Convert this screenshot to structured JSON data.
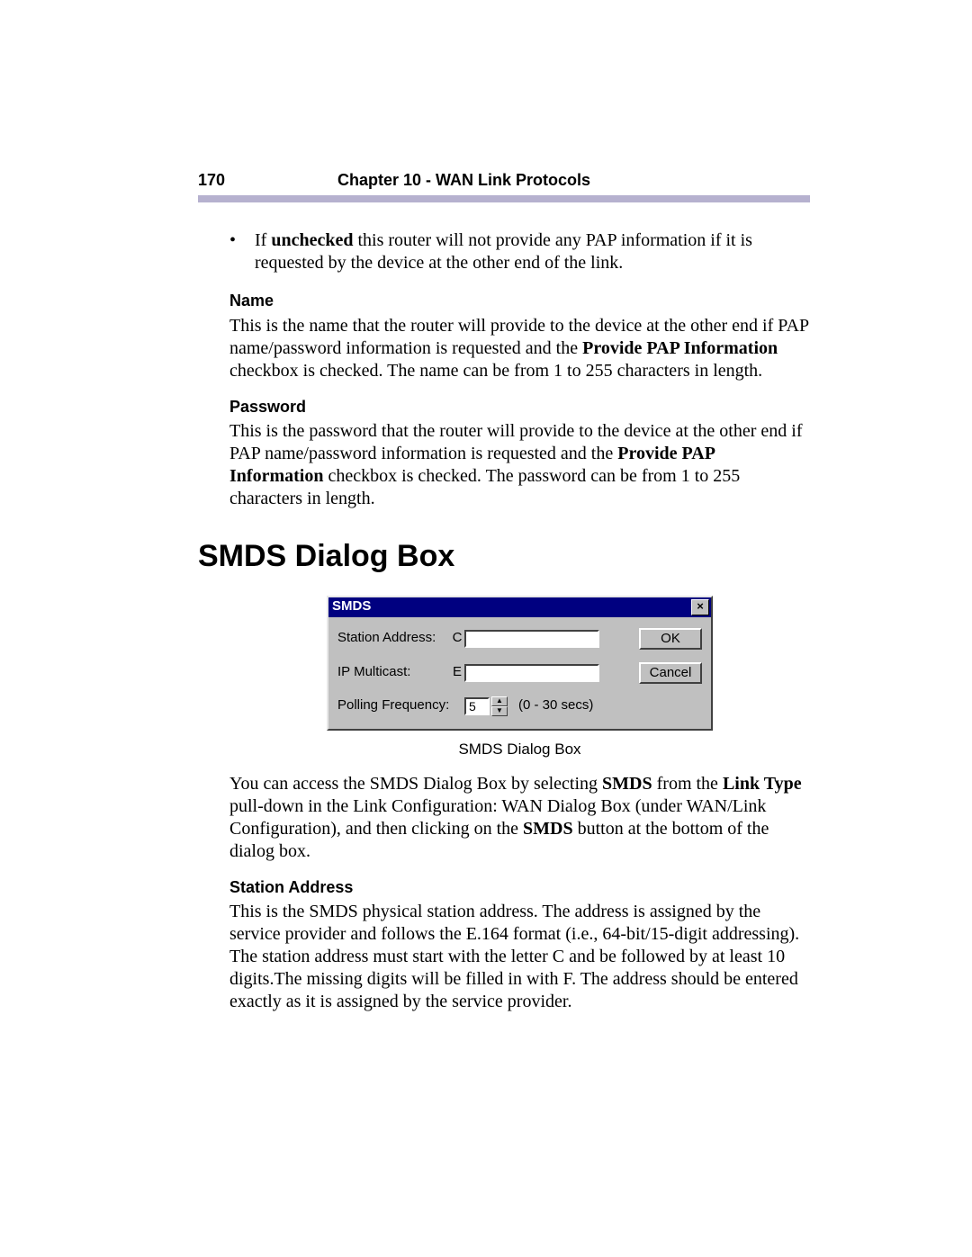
{
  "header": {
    "page_number": "170",
    "chapter": "Chapter 10 - WAN Link Protocols"
  },
  "bullet": {
    "prefix": "If ",
    "bold": "unchecked",
    "rest": " this router will not provide any PAP information if it is requested by the device at the other end of the link."
  },
  "name_section": {
    "heading": "Name",
    "p1": "This is the name that the router will provide to the device at the other end if PAP name/password information is requested and the ",
    "bold": "Provide PAP Information",
    "p2": " checkbox is checked. The name can be from 1 to 255 characters in length."
  },
  "password_section": {
    "heading": "Password",
    "p1": "This is the password that the router will provide to the device at the other end if PAP name/password information is requested and the ",
    "bold": "Provide PAP Information",
    "p2": " checkbox is checked. The password can be from 1 to 255 characters in length."
  },
  "section_title": "SMDS Dialog Box",
  "dialog": {
    "title": "SMDS",
    "close": "×",
    "station_label": "Station Address:",
    "station_prefix": "C",
    "station_value": "",
    "ip_label": "IP Multicast:",
    "ip_prefix": "E",
    "ip_value": "",
    "polling_label": "Polling Frequency:",
    "polling_value": "5",
    "polling_range": "(0 - 30 secs)",
    "up_glyph": "▲",
    "down_glyph": "▼",
    "ok": "OK",
    "cancel": "Cancel"
  },
  "caption": "SMDS Dialog Box",
  "access_para": {
    "t1": "You can access the SMDS Dialog Box by selecting ",
    "b1": "SMDS",
    "t2": " from the ",
    "b2": "Link Type",
    "t3": " pull-down in the Link Configuration: WAN Dialog Box (under WAN/Link Configuration), and then clicking on the ",
    "b3": "SMDS",
    "t4": " button at the bottom of the dialog box."
  },
  "station_section": {
    "heading": "Station Address",
    "text": "This is the SMDS physical station address. The address is assigned by the service provider and follows the E.164 format (i.e., 64-bit/15-digit addressing). The station  address must start with the letter C and be followed by at least 10 digits.The missing digits will be filled in with F. The address should be entered exactly as it is assigned by the service provider."
  }
}
